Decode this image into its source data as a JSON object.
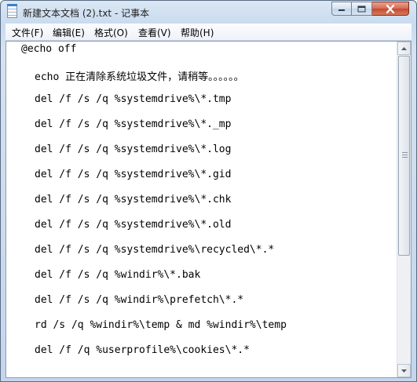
{
  "window": {
    "title": "新建文本文档 (2).txt - 记事本"
  },
  "menubar": {
    "items": [
      {
        "label": "文件(F)"
      },
      {
        "label": "编辑(E)"
      },
      {
        "label": "格式(O)"
      },
      {
        "label": "查看(V)"
      },
      {
        "label": "帮助(H)"
      }
    ]
  },
  "editor": {
    "lines": [
      "@echo off",
      "echo 正在清除系统垃圾文件，请稍等。。。。。。",
      "del /f /s /q %systemdrive%\\*.tmp",
      "del /f /s /q %systemdrive%\\*._mp",
      "del /f /s /q %systemdrive%\\*.log",
      "del /f /s /q %systemdrive%\\*.gid",
      "del /f /s /q %systemdrive%\\*.chk",
      "del /f /s /q %systemdrive%\\*.old",
      "del /f /s /q %systemdrive%\\recycled\\*.*",
      "del /f /s /q %windir%\\*.bak",
      "del /f /s /q %windir%\\prefetch\\*.*",
      "rd /s /q %windir%\\temp & md %windir%\\temp",
      "del /f /q %userprofile%\\cookies\\*.*"
    ]
  },
  "icons": {
    "app": "notepad-icon",
    "minimize": "minimize-icon",
    "maximize": "maximize-icon",
    "close": "close-icon",
    "scroll_up": "scroll-up-arrow-icon",
    "scroll_down": "scroll-down-arrow-icon"
  }
}
